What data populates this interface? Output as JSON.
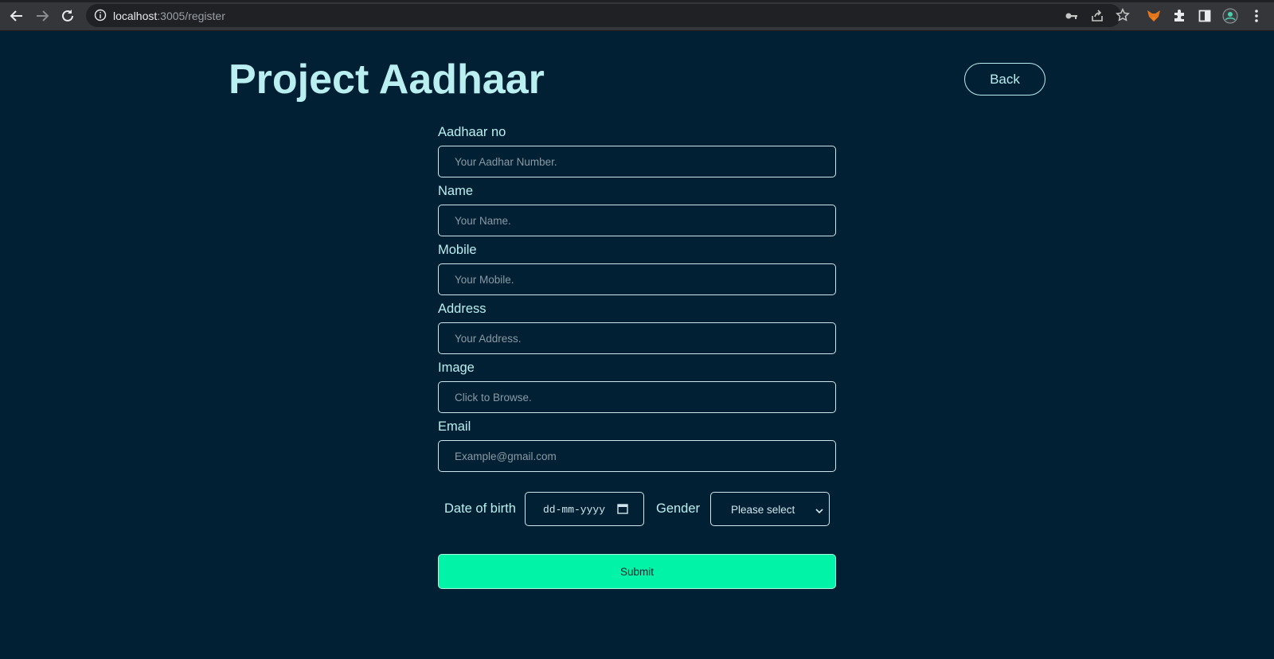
{
  "browser": {
    "url_host": "localhost",
    "url_path": ":3005/register",
    "icons": [
      "back-arrow-icon",
      "forward-arrow-icon",
      "reload-icon",
      "info-icon",
      "key-icon",
      "share-icon",
      "star-icon",
      "fox-extension-icon",
      "puzzle-extension-icon",
      "side-panel-icon",
      "profile-avatar-icon",
      "kebab-menu-icon"
    ]
  },
  "header": {
    "title": "Project Aadhaar",
    "back_label": "Back"
  },
  "form": {
    "fields": [
      {
        "label": "Aadhaar no",
        "placeholder": "Your Aadhar Number."
      },
      {
        "label": "Name",
        "placeholder": "Your Name."
      },
      {
        "label": "Mobile",
        "placeholder": "Your Mobile."
      },
      {
        "label": "Address",
        "placeholder": "Your Address."
      },
      {
        "label": "Image",
        "placeholder": "Click to Browse."
      },
      {
        "label": "Email",
        "placeholder": "Example@gmail.com"
      }
    ],
    "dob_label": "Date of birth",
    "dob_value": "dd-mm-yyyy",
    "gender_label": "Gender",
    "gender_selected": "Please select",
    "submit_label": "Submit"
  },
  "colors": {
    "background": "#022033",
    "accent_text": "#b9eff0",
    "submit_bg": "#00f3a6"
  }
}
